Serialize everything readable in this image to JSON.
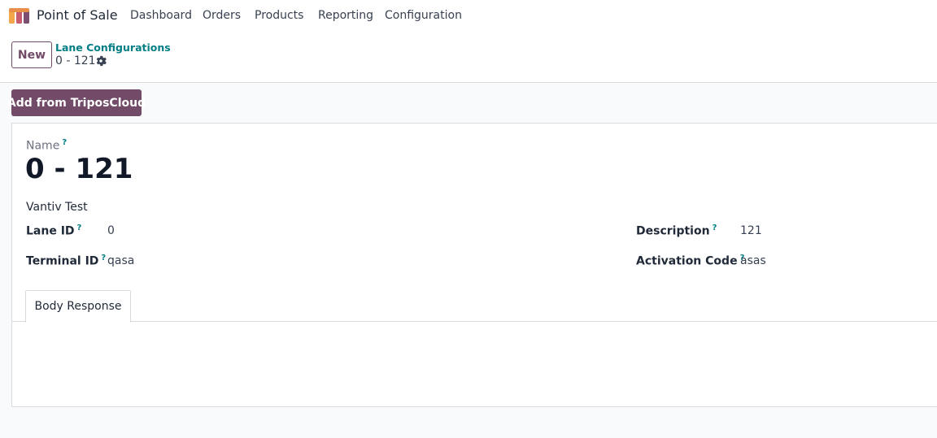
{
  "navbar": {
    "app_name": "Point of Sale",
    "logo_icon": "pos-logo-icon",
    "menu": [
      "Dashboard",
      "Orders",
      "Products",
      "Reporting",
      "Configuration"
    ]
  },
  "control_panel": {
    "new_label": "New",
    "breadcrumb_parent": "Lane Configurations",
    "breadcrumb_current": "0 - 121",
    "gear_icon": "gear-icon"
  },
  "actions": {
    "add_from_label": "Add from TriposCloud"
  },
  "form": {
    "name_label": "Name",
    "tooltip_mark": "?",
    "record_name": "0 - 121",
    "provider": "Vantiv Test",
    "fields": {
      "lane_id": {
        "label": "Lane ID",
        "value": "0"
      },
      "terminal_id": {
        "label": "Terminal ID",
        "value": "qasa"
      },
      "description": {
        "label": "Description",
        "value": "121"
      },
      "activation_code": {
        "label": "Activation Code",
        "value": "asas"
      }
    },
    "tabs": [
      "Body Response"
    ]
  },
  "colors": {
    "brand": "#714b67",
    "link": "#017e84",
    "border": "#d8dadd",
    "background": "#f9fafb"
  }
}
